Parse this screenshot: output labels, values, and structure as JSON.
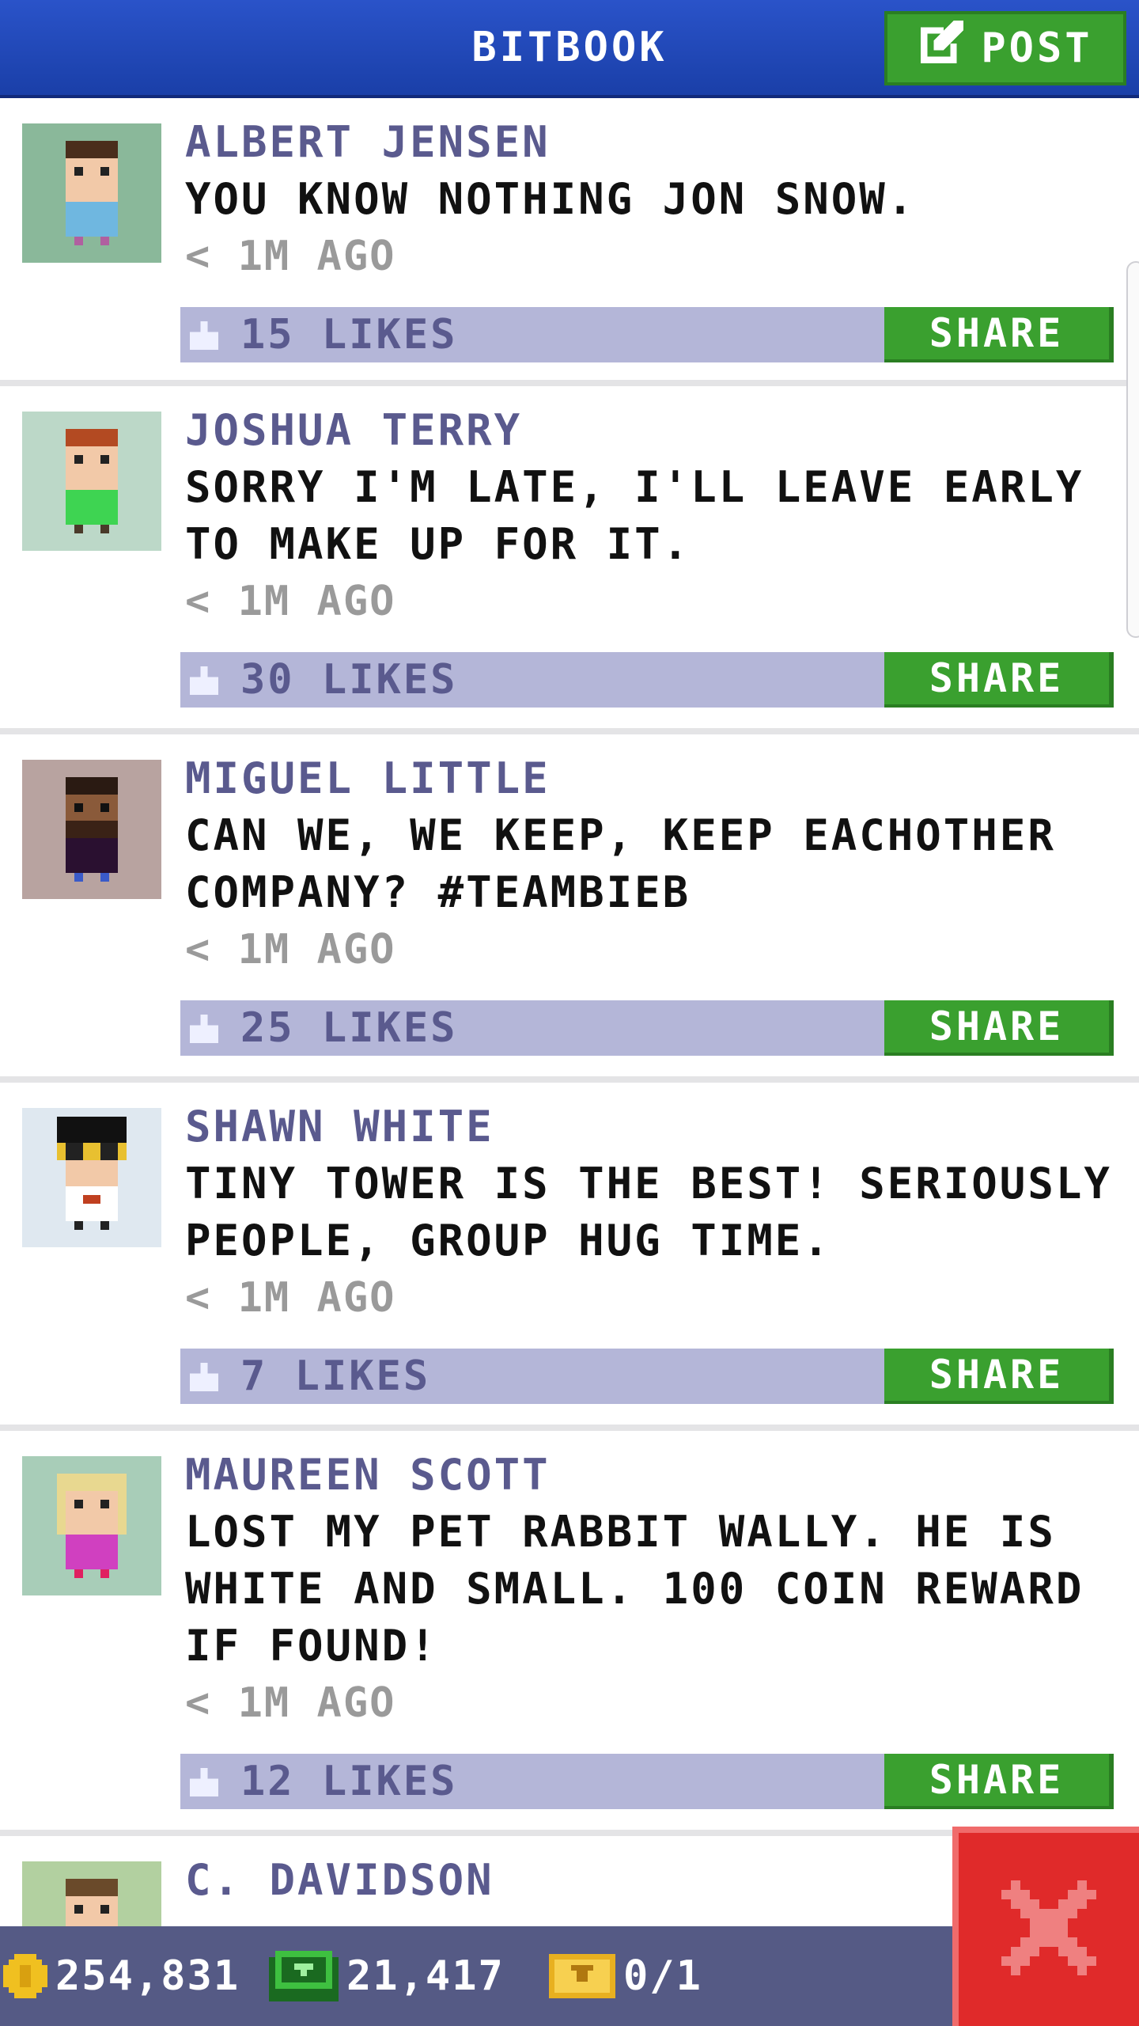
{
  "header": {
    "title": "BITBOOK",
    "post_label": "POST"
  },
  "posts": [
    {
      "author": "ALBERT JENSEN",
      "message": "YOU KNOW NOTHING JON SNOW.",
      "time": "< 1M AGO",
      "likes": "15 LIKES",
      "share_label": "SHARE"
    },
    {
      "author": "JOSHUA TERRY",
      "message": "SORRY I'M LATE, I'LL LEAVE EARLY TO MAKE UP FOR IT.",
      "time": "< 1M AGO",
      "likes": "30 LIKES",
      "share_label": "SHARE"
    },
    {
      "author": "MIGUEL LITTLE",
      "message": "CAN WE, WE KEEP, KEEP EACHOTHER COMPANY? #TEAMBIEB",
      "time": "< 1M AGO",
      "likes": "25 LIKES",
      "share_label": "SHARE"
    },
    {
      "author": "SHAWN WHITE",
      "message": "TINY TOWER IS THE BEST! SERIOUSLY PEOPLE, GROUP HUG TIME.",
      "time": "< 1M AGO",
      "likes": "7 LIKES",
      "share_label": "SHARE"
    },
    {
      "author": "MAUREEN SCOTT",
      "message": "LOST MY PET RABBIT WALLY. HE IS WHITE AND SMALL. 100 COIN REWARD IF FOUND!",
      "time": "< 1M AGO",
      "likes": "12 LIKES",
      "share_label": "SHARE"
    },
    {
      "author": "C. DAVIDSON"
    }
  ],
  "bottom_bar": {
    "coins": "254,831",
    "bux": "21,417",
    "tickets": "0/1"
  },
  "icons": {
    "post": "edit-icon",
    "like": "thumbs-up-icon",
    "coin": "coin-icon",
    "bux": "bux-icon",
    "ticket": "ticket-icon",
    "close": "close-icon"
  },
  "colors": {
    "header": "#2a53c9",
    "accent_green": "#3aa02f",
    "author": "#5a5a8e",
    "likes_bar": "#b4b6d8",
    "bottom_bar": "#555a85",
    "close": "#e02a2a"
  }
}
